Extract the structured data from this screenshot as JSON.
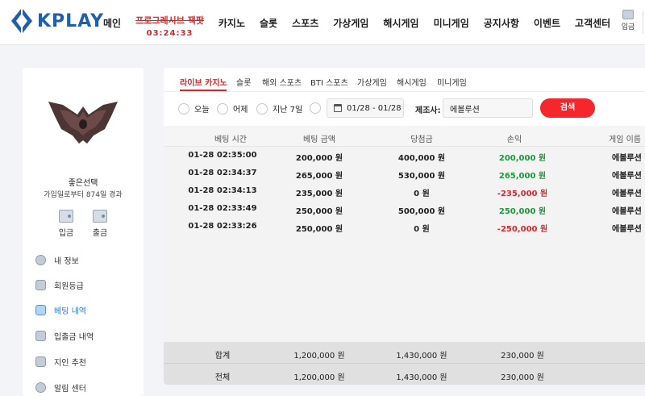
{
  "header": {
    "logo_text": "KPLAY",
    "nav": [
      "메인",
      "카지노",
      "슬롯",
      "스포츠",
      "가상게임",
      "해시게임",
      "미니게임",
      "공지사항",
      "이벤트",
      "고객센터"
    ],
    "promo_title": "프로그레시브 잭팟",
    "promo_time": "03:24:33",
    "login_label": "입금"
  },
  "sidebar": {
    "user_name": "좋은선택",
    "user_days": "가입일로부터 874일 경과",
    "deposit_label": "입금",
    "withdraw_label": "출금",
    "menu": [
      "내 정보",
      "회원등급",
      "베팅 내역",
      "입출금 내역",
      "지인 추천",
      "알림 센터"
    ]
  },
  "tabs": [
    "라이브 카지노",
    "슬롯",
    "해외 스포츠",
    "BTI 스포츠",
    "가상게임",
    "해시게임",
    "미니게임"
  ],
  "filters": {
    "today": "오늘",
    "yesterday": "어제",
    "last7": "지난 7일",
    "date_range": "01/28 - 01/28",
    "maker_label": "제조사:",
    "maker_value": "에볼루션",
    "search_label": "검색"
  },
  "table": {
    "headers": [
      "베팅 시간",
      "베팅 금액",
      "당첨금",
      "손익",
      "게임 이름"
    ],
    "rows": [
      {
        "time": "01-28 02:35:00",
        "bet": "200,000 원",
        "win": "400,000 원",
        "pl": "200,000 원",
        "game": "에볼루션",
        "sign": "pos"
      },
      {
        "time": "01-28 02:34:37",
        "bet": "265,000 원",
        "win": "530,000 원",
        "pl": "265,000 원",
        "game": "에볼루션",
        "sign": "pos"
      },
      {
        "time": "01-28 02:34:13",
        "bet": "235,000 원",
        "win": "0 원",
        "pl": "-235,000 원",
        "game": "에볼루션",
        "sign": "neg"
      },
      {
        "time": "01-28 02:33:49",
        "bet": "250,000 원",
        "win": "500,000 원",
        "pl": "250,000 원",
        "game": "에볼루션",
        "sign": "pos"
      },
      {
        "time": "01-28 02:33:26",
        "bet": "250,000 원",
        "win": "0 원",
        "pl": "-250,000 원",
        "game": "에볼루션",
        "sign": "neg"
      }
    ],
    "totals": [
      {
        "label": "합계",
        "bet": "1,200,000 원",
        "win": "1,430,000 원",
        "pl": "230,000 원"
      },
      {
        "label": "전체",
        "bet": "1,200,000 원",
        "win": "1,430,000 원",
        "pl": "230,000 원"
      }
    ]
  },
  "colors": {
    "accent": "#d9262b",
    "positive": "#1a9a3a",
    "negative": "#e0262b",
    "brand": "#1f5fae"
  }
}
